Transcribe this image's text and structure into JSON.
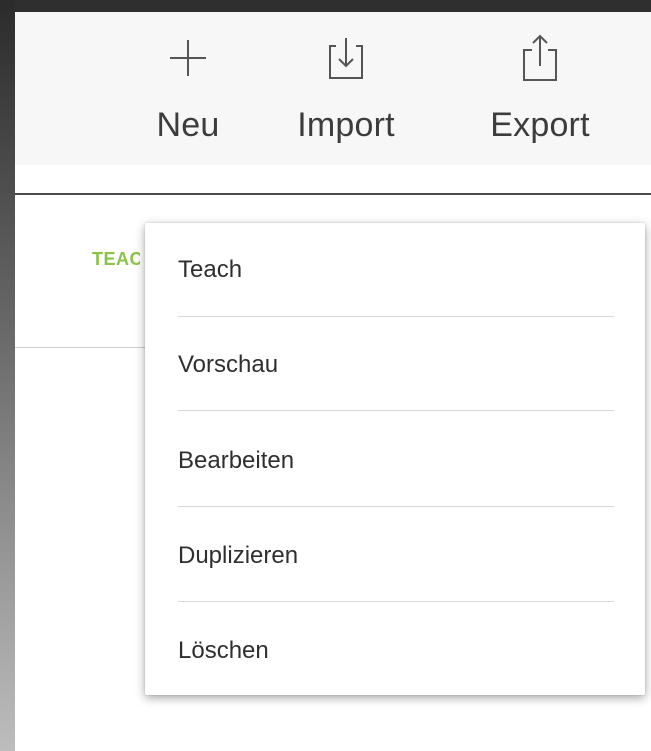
{
  "toolbar": {
    "new": {
      "label": "Neu",
      "icon": "plus-icon"
    },
    "import": {
      "label": "Import",
      "icon": "import-tray-icon"
    },
    "export": {
      "label": "Export",
      "icon": "share-export-icon"
    }
  },
  "tabs": {
    "active_label": "TEACH",
    "accent": "#8bc34a"
  },
  "context_menu": {
    "items": [
      {
        "label": "Teach"
      },
      {
        "label": "Vorschau"
      },
      {
        "label": "Bearbeiten"
      },
      {
        "label": "Duplizieren"
      },
      {
        "label": "Löschen"
      }
    ]
  }
}
